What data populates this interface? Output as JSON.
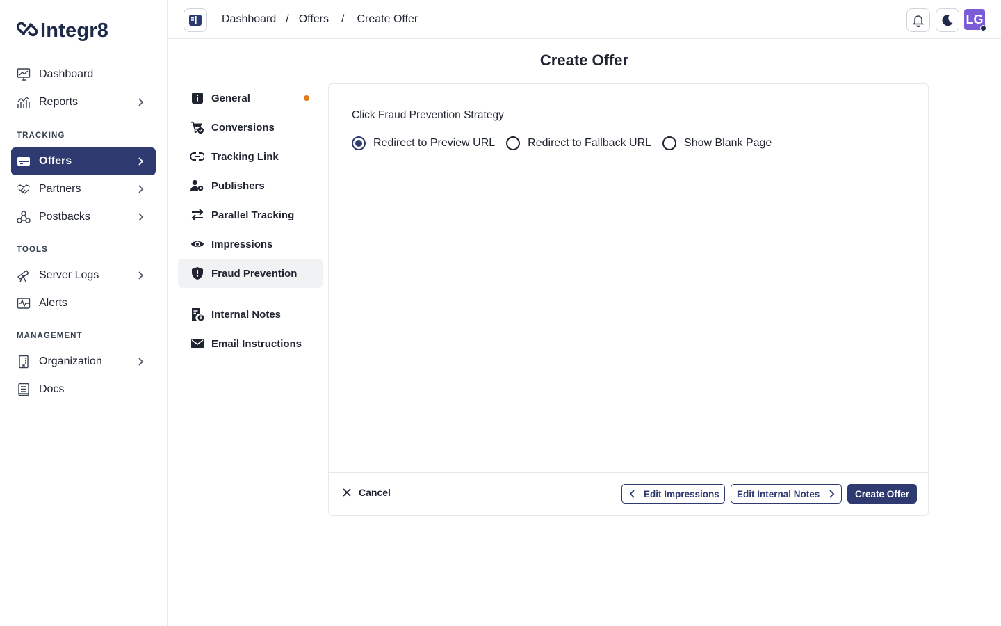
{
  "brand": {
    "name": "Integr8"
  },
  "sidebar": {
    "items": [
      {
        "label": "Dashboard",
        "icon": "chart-screen-icon"
      },
      {
        "label": "Reports",
        "icon": "bar-chart-icon"
      },
      {
        "label": "Offers",
        "icon": "offers-icon"
      },
      {
        "label": "Partners",
        "icon": "handshake-icon"
      },
      {
        "label": "Postbacks",
        "icon": "webhook-icon"
      },
      {
        "label": "Server Logs",
        "icon": "telescope-icon"
      },
      {
        "label": "Alerts",
        "icon": "pulse-icon"
      },
      {
        "label": "Organization",
        "icon": "building-icon"
      },
      {
        "label": "Docs",
        "icon": "document-icon"
      }
    ],
    "sections": {
      "tracking": "TRACKING",
      "tools": "TOOLS",
      "management": "MANAGEMENT"
    },
    "active": "Offers",
    "active_color": "#2e3a70"
  },
  "header": {
    "breadcrumbs": [
      "Dashboard",
      "Offers",
      "Create Offer"
    ],
    "separator": "/",
    "avatar_initials": "LG",
    "avatar_color": "#7c5cd6"
  },
  "page": {
    "title": "Create Offer"
  },
  "sections_menu": {
    "items": [
      {
        "label": "General",
        "icon": "info-icon",
        "indicator": "orange-dot"
      },
      {
        "label": "Conversions",
        "icon": "cart-check-icon"
      },
      {
        "label": "Tracking Link",
        "icon": "link-icon"
      },
      {
        "label": "Publishers",
        "icon": "users-gear-icon"
      },
      {
        "label": "Parallel Tracking",
        "icon": "arrows-swap-icon"
      },
      {
        "label": "Impressions",
        "icon": "eye-icon"
      },
      {
        "label": "Fraud Prevention",
        "icon": "shield-icon"
      },
      {
        "label": "Internal Notes",
        "icon": "notes-icon"
      },
      {
        "label": "Email Instructions",
        "icon": "envelope-icon"
      }
    ],
    "active": "Fraud Prevention",
    "indicator_color": "#e07b20"
  },
  "form": {
    "label": "Click Fraud Prevention Strategy",
    "options": [
      "Redirect to Preview URL",
      "Redirect to Fallback URL",
      "Show Blank Page"
    ],
    "selected": "Redirect to Preview URL"
  },
  "footer": {
    "cancel": "Cancel",
    "prev": "Edit Impressions",
    "next": "Edit Internal Notes",
    "submit": "Create Offer"
  }
}
